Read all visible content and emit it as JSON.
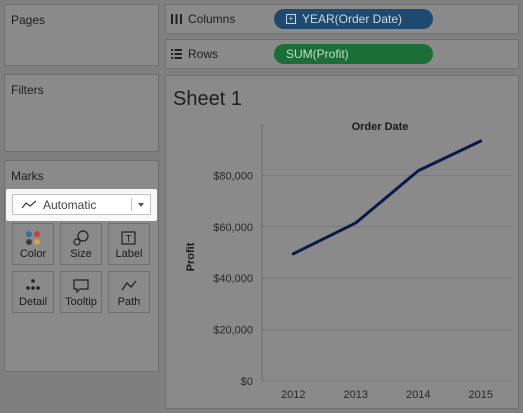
{
  "pages": {
    "title": "Pages"
  },
  "filters": {
    "title": "Filters"
  },
  "marks": {
    "title": "Marks",
    "mark_type": "Automatic",
    "buttons": [
      {
        "label": "Color"
      },
      {
        "label": "Size"
      },
      {
        "label": "Label"
      },
      {
        "label": "Detail"
      },
      {
        "label": "Tooltip"
      },
      {
        "label": "Path"
      }
    ],
    "color_dots": [
      "#2f6fae",
      "#c9413d",
      "#3a3a4a",
      "#d2a44d"
    ]
  },
  "columns": {
    "label": "Columns",
    "pill": "YEAR(Order Date)",
    "pill_color": "#1f4a6f"
  },
  "rows": {
    "label": "Rows",
    "pill": "SUM(Profit)",
    "pill_color": "#1a6e36"
  },
  "sheet": {
    "title": "Sheet 1"
  },
  "chart_data": {
    "type": "line",
    "title": "Order Date",
    "ylabel": "Profit",
    "x": [
      "2012",
      "2013",
      "2014",
      "2015"
    ],
    "series": [
      {
        "values": [
          49500,
          61500,
          81800,
          93400
        ]
      }
    ],
    "ylim": [
      0,
      100000
    ],
    "yticks": [
      {
        "value": 0,
        "label": "$0"
      },
      {
        "value": 20000,
        "label": "$20,000"
      },
      {
        "value": 40000,
        "label": "$40,000"
      },
      {
        "value": 60000,
        "label": "$60,000"
      },
      {
        "value": 80000,
        "label": "$80,000"
      }
    ],
    "line_color": "#0b1a4a",
    "grid": true
  }
}
